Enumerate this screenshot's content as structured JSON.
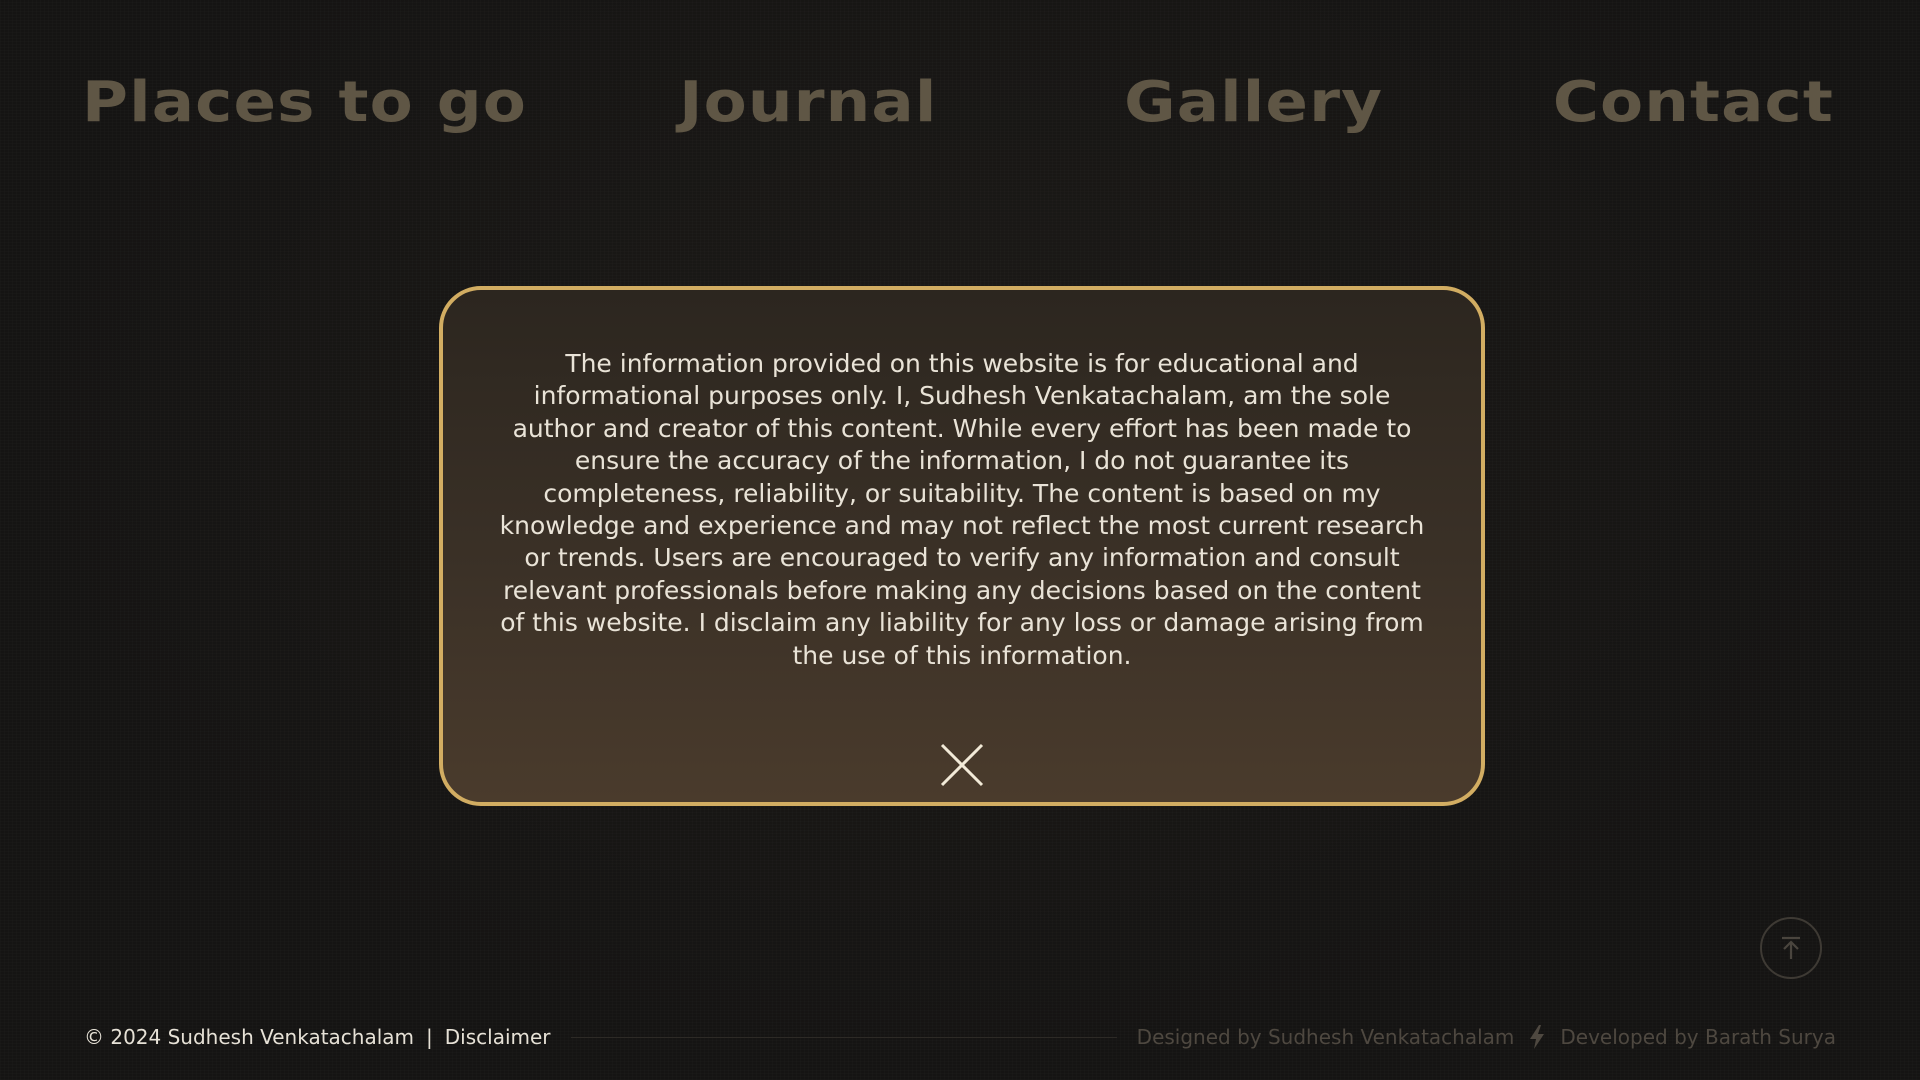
{
  "nav": {
    "items": [
      {
        "label": "Places to go"
      },
      {
        "label": "Journal"
      },
      {
        "label": "Gallery"
      },
      {
        "label": "Contact"
      }
    ]
  },
  "modal": {
    "text": "The information provided on this website is for educational and informational purposes only. I, Sudhesh Venkatachalam, am the sole author and creator of this content. While every effort has been made to ensure the accuracy of the information, I do not guarantee its completeness, reliability, or suitability. The content is based on my knowledge and experience and may not reflect the most current research or trends. Users are encouraged to verify any information and consult relevant professionals before making any decisions based on the content of this website. I disclaim any liability for any loss or damage arising from the use of this information.",
    "close_icon": "close-icon"
  },
  "footer": {
    "copyright": "© 2024 Sudhesh Venkatachalam",
    "separator": "|",
    "disclaimer": "Disclaimer",
    "designed_by": "Designed by Sudhesh Venkatachalam",
    "developed_by": "Developed by Barath Surya",
    "scroll_top_icon": "arrow-up-to-top-icon",
    "bolt_icon": "lightning-bolt-icon"
  },
  "colors": {
    "background": "#151413",
    "nav_text": "#5f5645",
    "modal_border": "#d2ad62",
    "modal_text": "#e9e3d7",
    "footer_muted": "#4e4840"
  }
}
